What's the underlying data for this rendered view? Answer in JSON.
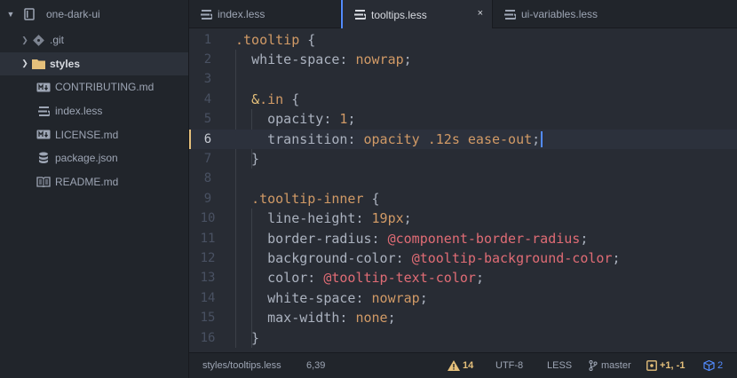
{
  "tree": {
    "root": {
      "name": "one-dark-ui"
    },
    "items": [
      {
        "name": ".git",
        "type": "folder",
        "icon": "git-icon",
        "expanded": false
      },
      {
        "name": "styles",
        "type": "folder",
        "icon": "folder-icon",
        "expanded": false,
        "selected": true
      },
      {
        "name": "CONTRIBUTING.md",
        "type": "file",
        "icon": "markdown-icon"
      },
      {
        "name": "index.less",
        "type": "file",
        "icon": "less-icon"
      },
      {
        "name": "LICENSE.md",
        "type": "file",
        "icon": "markdown-icon"
      },
      {
        "name": "package.json",
        "type": "file",
        "icon": "json-icon"
      },
      {
        "name": "README.md",
        "type": "file",
        "icon": "book-icon"
      }
    ]
  },
  "tabs": [
    {
      "label": "index.less",
      "active": false
    },
    {
      "label": "tooltips.less",
      "active": true,
      "close": "×"
    },
    {
      "label": "ui-variables.less",
      "active": false
    }
  ],
  "editor": {
    "cursor_line": 6,
    "lines": [
      {
        "n": "1",
        "code": ".tooltip {"
      },
      {
        "n": "2",
        "code": "  white-space: nowrap;"
      },
      {
        "n": "3",
        "code": ""
      },
      {
        "n": "4",
        "code": "  &.in {"
      },
      {
        "n": "5",
        "code": "    opacity: 1;"
      },
      {
        "n": "6",
        "code": "    transition: opacity .12s ease-out;"
      },
      {
        "n": "7",
        "code": "  }"
      },
      {
        "n": "8",
        "code": ""
      },
      {
        "n": "9",
        "code": "  .tooltip-inner {"
      },
      {
        "n": "10",
        "code": "    line-height: 19px;"
      },
      {
        "n": "11",
        "code": "    border-radius: @component-border-radius;"
      },
      {
        "n": "12",
        "code": "    background-color: @tooltip-background-color;"
      },
      {
        "n": "13",
        "code": "    color: @tooltip-text-color;"
      },
      {
        "n": "14",
        "code": "    white-space: nowrap;"
      },
      {
        "n": "15",
        "code": "    max-width: none;"
      },
      {
        "n": "16",
        "code": "  }"
      }
    ]
  },
  "status": {
    "path": "styles/tooltips.less",
    "position": "6,39",
    "warnings": "14",
    "encoding": "UTF-8",
    "grammar": "LESS",
    "branch": "master",
    "diff": "+1, -1",
    "packages": "2"
  },
  "colors": {
    "accent": "#528bff",
    "selector": "#d19a66",
    "variable": "#e06c75",
    "warning": "#e5c07b",
    "diff": "#e5c07b",
    "packages": "#528bff"
  }
}
